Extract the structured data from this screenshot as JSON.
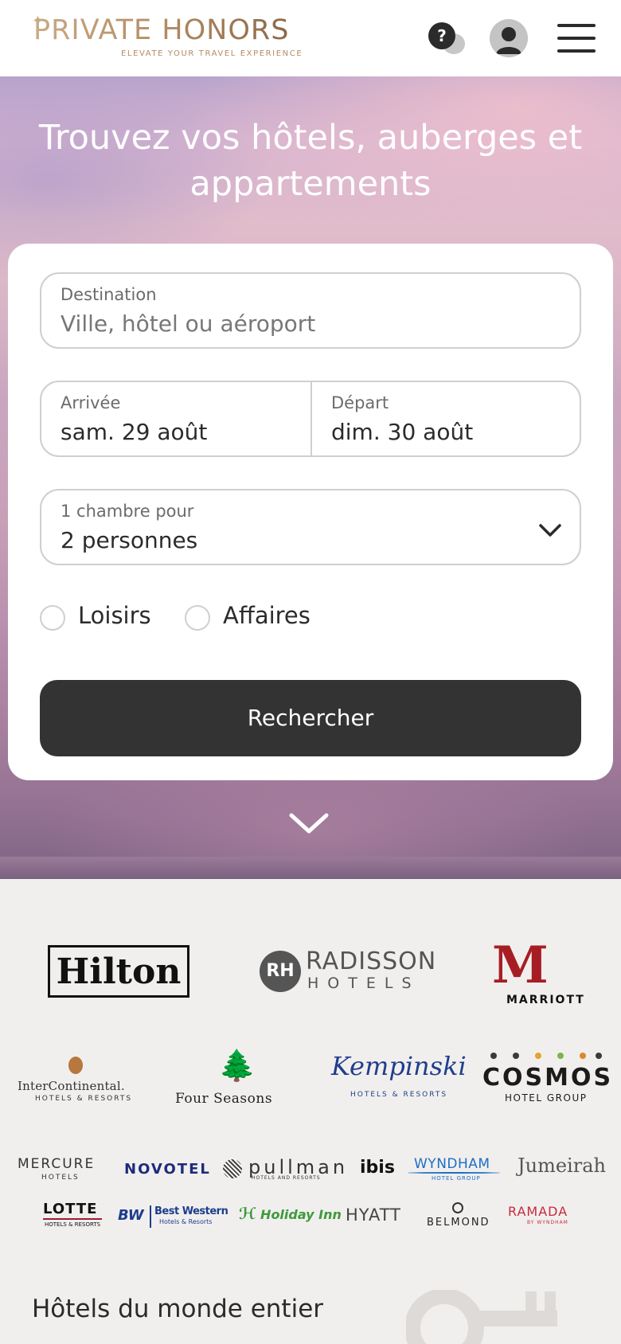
{
  "header": {
    "logo_text": "PRIVATE HONORS",
    "logo_tagline": "ELEVATE YOUR TRAVEL EXPERIENCE",
    "help_symbol": "?",
    "icons": [
      "help-chat-icon",
      "user-avatar-icon",
      "hamburger-menu-icon"
    ],
    "colors": {
      "logo_gold": "#b48b63",
      "dark": "#2b2b2b"
    }
  },
  "hero": {
    "title": "Trouvez vos hôtels, auberges et appartements"
  },
  "search_form": {
    "destination": {
      "label": "Destination",
      "placeholder": "Ville, hôtel ou aéroport"
    },
    "arrival": {
      "label": "Arrivée",
      "value": "sam. 29 août"
    },
    "departure": {
      "label": "Départ",
      "value": "dim. 30 août"
    },
    "rooms": {
      "label": "1 chambre pour",
      "value": "2 personnes"
    },
    "trip_types": [
      {
        "label": "Loisirs",
        "checked": false
      },
      {
        "label": "Affaires",
        "checked": false
      }
    ],
    "submit_label": "Rechercher",
    "colors": {
      "button": "#333333",
      "border": "#cfcfcf"
    }
  },
  "brands": {
    "hilton": "Hilton",
    "radisson": {
      "badge": "RH",
      "line1": "RADISSON",
      "line2": "HOTELS"
    },
    "marriott": {
      "mark": "M",
      "name": "MARRIOTT"
    },
    "intercontinental": {
      "name": "InterContinental.",
      "sub": "HOTELS & RESORTS"
    },
    "four_seasons": {
      "mark": "🌲",
      "name": "Four Seasons"
    },
    "kempinski": {
      "name": "Kempinski",
      "sub": "HOTELS & RESORTS"
    },
    "cosmos": {
      "name": "COSMOS",
      "sub": "HOTEL GROUP"
    },
    "mercure": {
      "name": "MERCURE",
      "sub": "HOTELS"
    },
    "novotel": "NOVOTEL",
    "pullman": {
      "name": "pullman",
      "sub": "HOTELS AND RESORTS"
    },
    "ibis": "ibis",
    "wyndham": {
      "name": "WYNDHAM",
      "sub": "HOTEL GROUP"
    },
    "jumeirah": "Jumeirah",
    "lotte": {
      "name": "LOTTE",
      "sub": "HOTELS & RESORTS"
    },
    "best_western": {
      "mark": "BW",
      "name": "Best Western",
      "sub": "Hotels & Resorts"
    },
    "holiday_inn": "Holiday Inn",
    "hyatt": "HYATT",
    "belmond": "BELMOND",
    "ramada": {
      "name": "RAMADA",
      "sub": "BY WYNDHAM"
    }
  },
  "section": {
    "title": "Hôtels du monde entier"
  }
}
